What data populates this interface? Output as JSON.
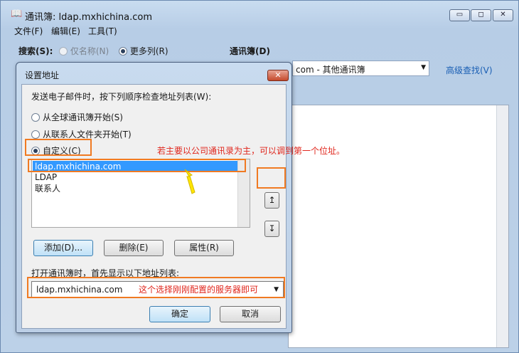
{
  "window": {
    "title": "通讯簿: ldap.mxhichina.com",
    "menu": [
      "文件(F)",
      "编辑(E)",
      "工具(T)"
    ],
    "controls": {
      "min": "▭",
      "max": "◻",
      "close": "✕"
    }
  },
  "search": {
    "label": "搜索(S):",
    "option_name": "仅名称(N)",
    "option_more": "更多列(R)",
    "book_label": "通讯簿(D)",
    "book_value": "com - 其他通讯簿",
    "advanced": "高级查找(V)"
  },
  "dialog": {
    "title": "设置地址",
    "order_label": "发送电子邮件时，按下列顺序检查地址列表(W):",
    "options": [
      "从全球通讯簿开始(S)",
      "从联系人文件夹开始(T)",
      "自定义(C)"
    ],
    "selected_option": 2,
    "address_list": [
      "ldap.mxhichina.com",
      "LDAP",
      "联系人"
    ],
    "selected_row": 0,
    "up_button": "↥",
    "down_button": "↧",
    "add_button": "添加(D)...",
    "delete_button": "删除(E)",
    "properties_button": "属性(R)",
    "open_label": "打开通讯簿时，首先显示以下地址列表:",
    "default_list": "ldap.mxhichina.com",
    "ok_button": "确定",
    "cancel_button": "取消"
  },
  "annotations": {
    "note_top": "若主要以公司通讯录为主，可以调到第一个位址。",
    "note_select": "这个选择刚刚配置的服务器即可",
    "highlight_color": "#f07a22",
    "note_color": "#e0261c",
    "arrow_color": "#ffe600"
  },
  "icons": {
    "app": "address-book-icon",
    "dropdown": "▼"
  }
}
